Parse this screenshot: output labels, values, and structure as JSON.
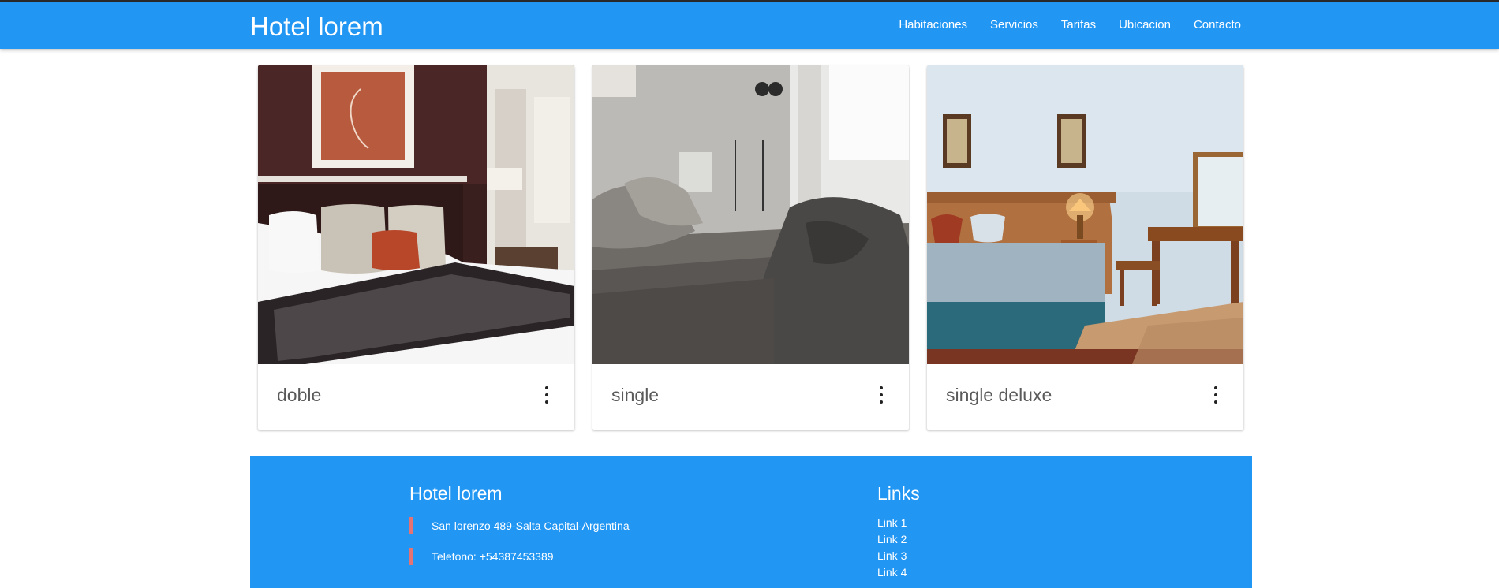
{
  "navbar": {
    "brand": "Hotel lorem",
    "links": [
      "Habitaciones",
      "Servicios",
      "Tarifas",
      "Ubicacion",
      "Contacto"
    ]
  },
  "rooms": [
    {
      "title": "doble",
      "menu_icon": "more-vert-icon"
    },
    {
      "title": "single",
      "menu_icon": "more-vert-icon"
    },
    {
      "title": "single deluxe",
      "menu_icon": "more-vert-icon"
    }
  ],
  "footer": {
    "title": "Hotel lorem",
    "address": "San lorenzo 489-Salta Capital-Argentina",
    "phone": "Telefono: +54387453389",
    "links_title": "Links",
    "links": [
      "Link 1",
      "Link 2",
      "Link 3",
      "Link 4"
    ]
  },
  "colors": {
    "primary": "#2196f3",
    "accent_bar": "#e57373",
    "card_title": "#5a5a5a"
  }
}
